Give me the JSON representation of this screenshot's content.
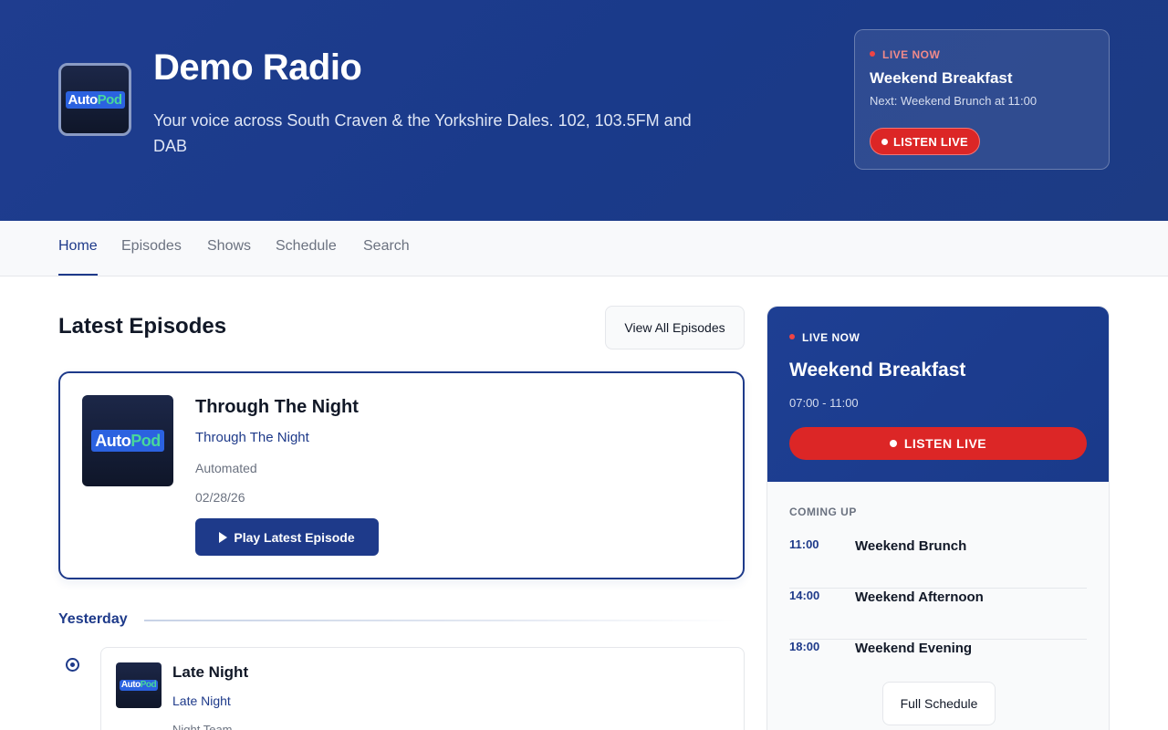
{
  "header": {
    "logo": {
      "part1": "Auto",
      "part2": "Pod"
    },
    "title": "Demo Radio",
    "tagline": "Your voice across South Craven & the Yorkshire Dales. 102, 103.5FM and DAB",
    "live_card": {
      "label": "LIVE NOW",
      "show": "Weekend Breakfast",
      "next": "Next: Weekend Brunch at 11:00",
      "listen_label": "LISTEN LIVE"
    }
  },
  "nav": {
    "items": [
      {
        "label": "Home",
        "active": true
      },
      {
        "label": "Episodes"
      },
      {
        "label": "Shows"
      },
      {
        "label": "Schedule"
      },
      {
        "label": "Search"
      }
    ]
  },
  "main": {
    "section_title": "Latest Episodes",
    "view_all_label": "View All Episodes",
    "featured": {
      "title": "Through The Night",
      "show": "Through The Night",
      "host": "Automated",
      "date": "02/28/26",
      "play_label": "Play Latest Episode"
    },
    "day_group": "Yesterday",
    "episodes": [
      {
        "title": "Late Night",
        "show": "Late Night",
        "host": "Night Team"
      }
    ]
  },
  "sidebar": {
    "live_label": "LIVE NOW",
    "show": "Weekend Breakfast",
    "time": "07:00 - 11:00",
    "listen_label": "LISTEN LIVE",
    "coming_up_label": "COMING UP",
    "coming_up": [
      {
        "time": "11:00",
        "name": "Weekend Brunch"
      },
      {
        "time": "14:00",
        "name": "Weekend Afternoon"
      },
      {
        "time": "18:00",
        "name": "Weekend Evening"
      }
    ],
    "full_schedule_label": "Full Schedule"
  },
  "colors": {
    "brand": "#1e3a8a",
    "live": "#dc2626",
    "logo_accent": "#48d79b",
    "logo_bg": "#2b62e0"
  },
  "icons": [
    "play-icon",
    "live-dot-icon",
    "timeline-marker-icon"
  ]
}
